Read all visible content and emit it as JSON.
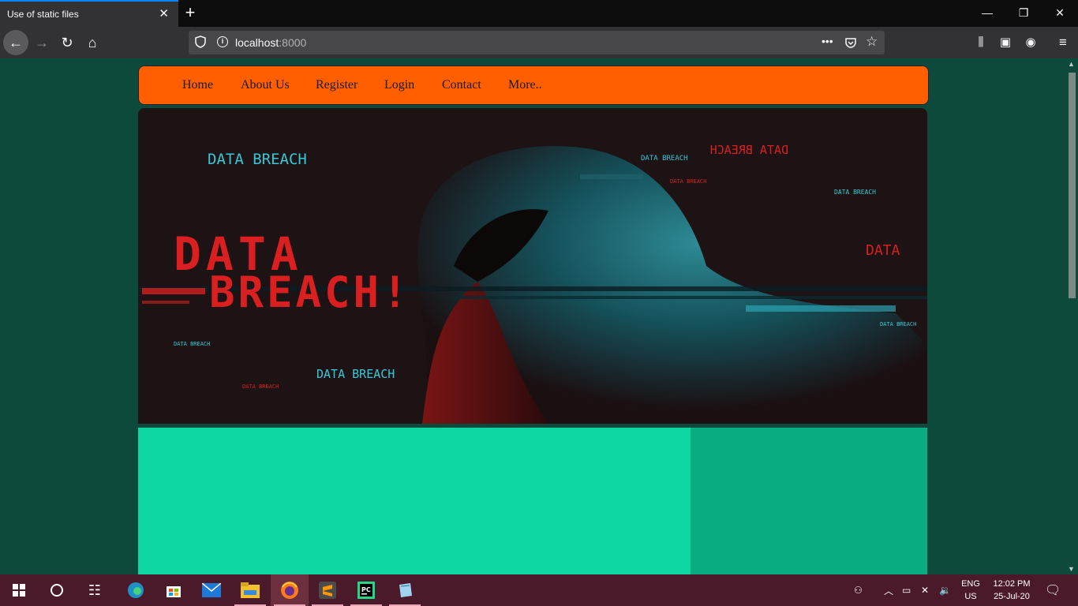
{
  "browser": {
    "tab_title": "Use of static files",
    "tab_close": "✕",
    "new_tab": "+",
    "url_host": "localhost",
    "url_port": ":8000",
    "window_controls": [
      "—",
      "❐",
      "✕"
    ]
  },
  "site": {
    "nav_items": [
      "Home",
      "About Us",
      "Register",
      "Login",
      "Contact",
      "More.."
    ],
    "hero_texts": {
      "main_line1": "DATA",
      "main_line2": "BREACH!",
      "small": "DATA BREACH",
      "mirrored": "DATA BREACH",
      "right_data": "DATA"
    },
    "colors": {
      "page_bg": "#0e4a3c",
      "nav_bg": "#ff5f00",
      "left_panel": "#0dd6a3",
      "right_panel": "#09ad81"
    }
  },
  "taskbar": {
    "lang_top": "ENG",
    "lang_bottom": "US",
    "time": "12:02 PM",
    "date": "25-Jul-20",
    "apps": [
      "windows-start-icon",
      "search-circle-icon",
      "task-view-icon",
      "edge-icon",
      "store-icon",
      "mail-icon",
      "file-explorer-icon",
      "firefox-icon",
      "sublime-icon",
      "pycharm-icon",
      "notepad-icon"
    ]
  }
}
